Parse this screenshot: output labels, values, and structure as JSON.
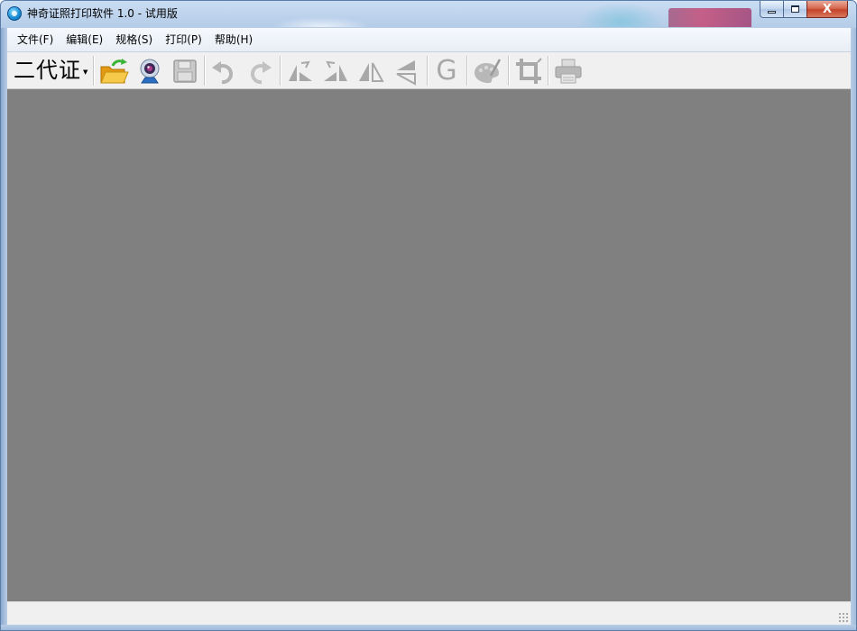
{
  "window": {
    "title": "神奇证照打印软件 1.0 - 试用版",
    "icon": "app-logo-icon",
    "controls": {
      "minimize_icon": "minimize-icon",
      "maximize_icon": "maximize-icon",
      "close_label": "X"
    }
  },
  "menubar": {
    "items": [
      {
        "label": "文件(F)"
      },
      {
        "label": "编辑(E)"
      },
      {
        "label": "规格(S)"
      },
      {
        "label": "打印(P)"
      },
      {
        "label": "帮助(H)"
      }
    ]
  },
  "toolbar": {
    "spec_select": {
      "value": "二代证",
      "arrow": "▼"
    },
    "buttons": [
      {
        "icon": "open-folder-icon",
        "enabled": true
      },
      {
        "icon": "webcam-icon",
        "enabled": true
      },
      {
        "icon": "save-disk-icon",
        "enabled": false
      },
      {
        "icon": "undo-icon",
        "enabled": false
      },
      {
        "icon": "redo-icon",
        "enabled": false
      },
      {
        "icon": "rotate-left-icon",
        "enabled": false
      },
      {
        "icon": "rotate-right-icon",
        "enabled": false
      },
      {
        "icon": "flip-horizontal-icon",
        "enabled": false
      },
      {
        "icon": "flip-vertical-icon",
        "enabled": false
      },
      {
        "icon": "grayscale-icon",
        "label": "G",
        "enabled": false
      },
      {
        "icon": "color-palette-icon",
        "enabled": false
      },
      {
        "icon": "crop-icon",
        "enabled": false
      },
      {
        "icon": "printer-icon",
        "enabled": false
      }
    ]
  },
  "colors": {
    "canvas": "#808080",
    "disabled_icon": "#a8a8a8",
    "folder_yellow": "#f2b731",
    "refresh_green": "#3cb43c",
    "close_red": "#c4432a"
  }
}
